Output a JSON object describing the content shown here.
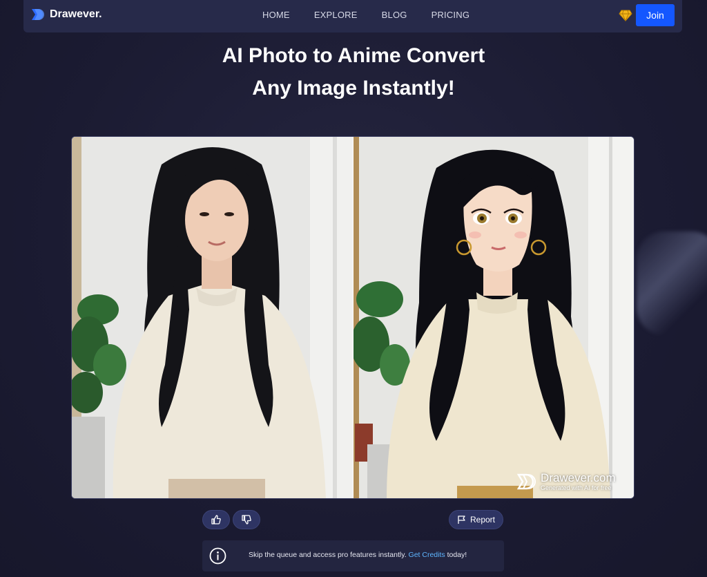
{
  "brand": {
    "name": "Drawever."
  },
  "nav": {
    "items": [
      {
        "label": "HOME"
      },
      {
        "label": "EXPLORE"
      },
      {
        "label": "BLOG"
      },
      {
        "label": "PRICING"
      }
    ],
    "join_label": "Join"
  },
  "hero": {
    "line1": "AI Photo to Anime Convert",
    "line2": "Any Image Instantly!"
  },
  "compare": {
    "left_icon": "photo-original",
    "right_icon": "anime-result",
    "watermark_title": "Drawever.com",
    "watermark_sub": "Generated with AI for free"
  },
  "actions": {
    "like_icon": "thumbs-up-icon",
    "dislike_icon": "thumbs-down-icon",
    "report_label": "Report"
  },
  "info": {
    "text_before": "Skip the queue and access pro features instantly.",
    "link_label": "Get Credits",
    "text_after": "today!"
  },
  "colors": {
    "accent": "#1457ff",
    "link": "#5fb6ff",
    "background": "#1c1c34",
    "navbar": "#272a4a"
  }
}
